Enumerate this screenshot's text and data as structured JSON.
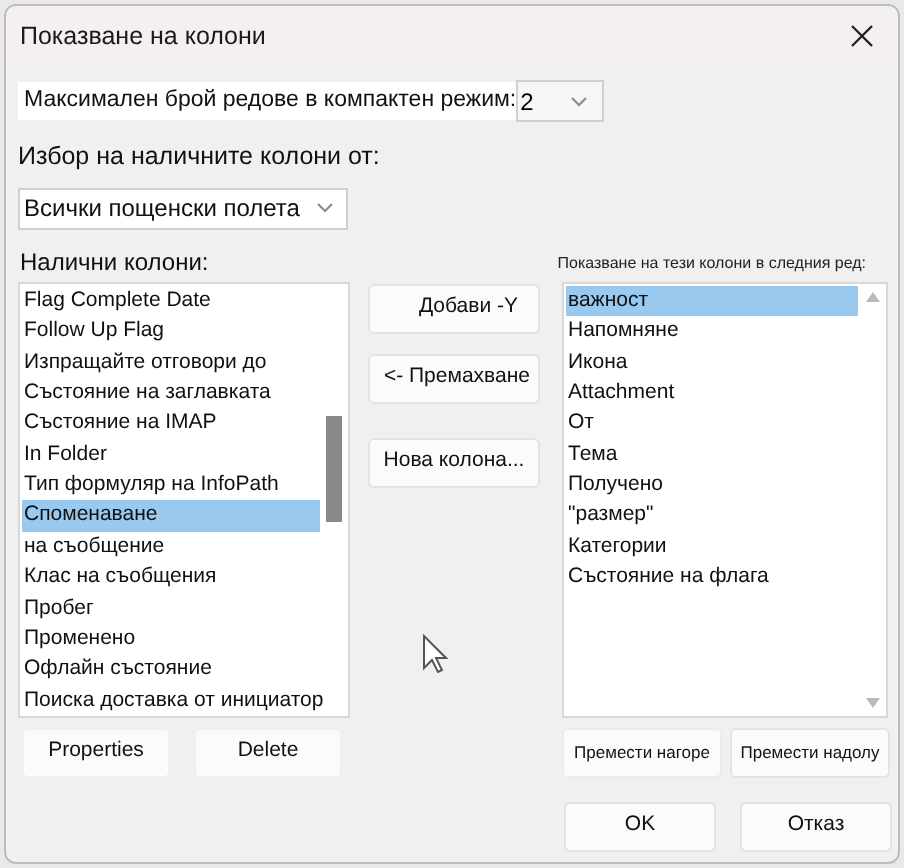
{
  "window": {
    "title": "Показване на колони"
  },
  "compact": {
    "label": "Максимален брой редове в компактен режим:",
    "value": "2"
  },
  "source": {
    "label": "Избор на наличните колони от:",
    "value": "Всички пощенски полета"
  },
  "available": {
    "label": "Налични колони:",
    "items": [
      {
        "text": "Flag Complete Date",
        "selected": false
      },
      {
        "text": "Follow Up Flag",
        "selected": false
      },
      {
        "text": "Изпращайте отговори до",
        "selected": false
      },
      {
        "text": "Състояние на заглавката",
        "selected": false
      },
      {
        "text": "Състояние на IMAP",
        "selected": false
      },
      {
        "text": "In Folder",
        "selected": false
      },
      {
        "text": "Тип формуляр на InfoPath",
        "selected": false
      },
      {
        "text": "Споменаване",
        "selected": true
      },
      {
        "text": "на съобщение",
        "selected": false
      },
      {
        "text": "Клас на съобщения",
        "selected": false
      },
      {
        "text": "Пробег",
        "selected": false
      },
      {
        "text": "Променено",
        "selected": false
      },
      {
        "text": "Офлайн състояние",
        "selected": false
      },
      {
        "text": "Поиска доставка от инициатор",
        "selected": false
      }
    ]
  },
  "middle_buttons": [
    "Добави -Y",
    "<- Премахване",
    "Нова колона..."
  ],
  "shown": {
    "label": "Показване на тези колони в следния ред:",
    "items": [
      {
        "text": "важност",
        "selected": true
      },
      {
        "text": "Напомняне",
        "selected": false
      },
      {
        "text": "Икона",
        "selected": false
      },
      {
        "text": "Attachment",
        "selected": false
      },
      {
        "text": "От",
        "selected": false
      },
      {
        "text": "Тема",
        "selected": false
      },
      {
        "text": "Получено",
        "selected": false
      },
      {
        "text": "\"размер\"",
        "selected": false
      },
      {
        "text": "Категории",
        "selected": false
      },
      {
        "text": "Състояние на флага",
        "selected": false
      }
    ]
  },
  "left_buttons": [
    "Properties",
    "Delete"
  ],
  "move_buttons": [
    "Премести нагоре",
    "Премести надолу"
  ],
  "dialog_buttons": [
    "OK",
    "Отказ"
  ]
}
